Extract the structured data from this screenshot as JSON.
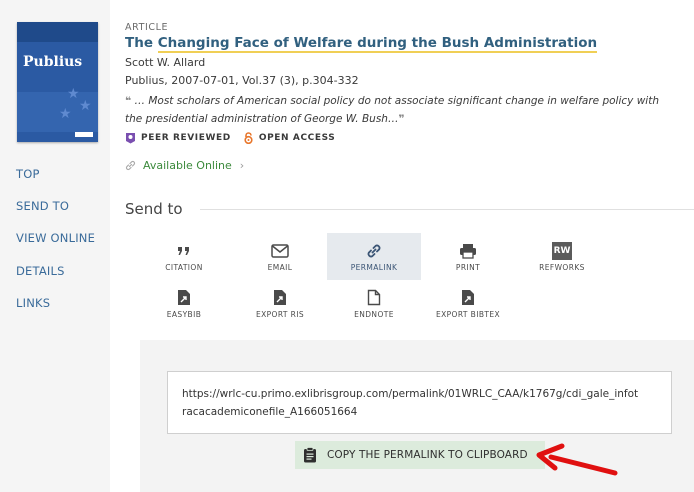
{
  "cover": {
    "title": "Publius"
  },
  "nav": {
    "top": "TOP",
    "send_to": "SEND TO",
    "view_online": "VIEW ONLINE",
    "details": "DETAILS",
    "links": "LINKS"
  },
  "record": {
    "type": "ARTICLE",
    "title_prefix": "The ",
    "title_highlight": "Changing Face of Welfare during the Bush Administration",
    "author": "Scott W. Allard",
    "source": "Publius, 2007-07-01, Vol.37 (3), p.304-332",
    "abstract_line1": "… Most scholars of American social policy do not associate significant change in welfare policy with",
    "abstract_line2": "the presidential administration of George W. Bush…",
    "peer_reviewed": "PEER REVIEWED",
    "open_access": "OPEN ACCESS",
    "availability": "Available Online",
    "open_access_color": "#e8762b",
    "peer_reviewed_color": "#7a4fb0"
  },
  "sendto": {
    "title": "Send to",
    "actions": [
      {
        "label": "CITATION",
        "icon": "quote-icon"
      },
      {
        "label": "EMAIL",
        "icon": "envelope-icon"
      },
      {
        "label": "PERMALINK",
        "icon": "link-icon"
      },
      {
        "label": "PRINT",
        "icon": "printer-icon"
      },
      {
        "label": "REFWORKS",
        "icon": "refworks-icon",
        "icon_text": "RW"
      },
      {
        "label": "EASYBIB",
        "icon": "export-file-icon"
      },
      {
        "label": "EXPORT RIS",
        "icon": "export-file-icon"
      },
      {
        "label": "ENDNOTE",
        "icon": "document-icon"
      },
      {
        "label": "EXPORT BIBTEX",
        "icon": "export-file-icon"
      }
    ],
    "selected": "PERMALINK"
  },
  "permalink": {
    "line1": "https://wrlc-cu.primo.exlibrisgroup.com/permalink/01WRLC_CAA/k1767g/cdi_gale_infot",
    "line2": "racacademiconefile_A166051664",
    "copy_label": "COPY THE PERMALINK TO CLIPBOARD"
  },
  "annotation": {
    "arrow_color": "#e01010"
  }
}
